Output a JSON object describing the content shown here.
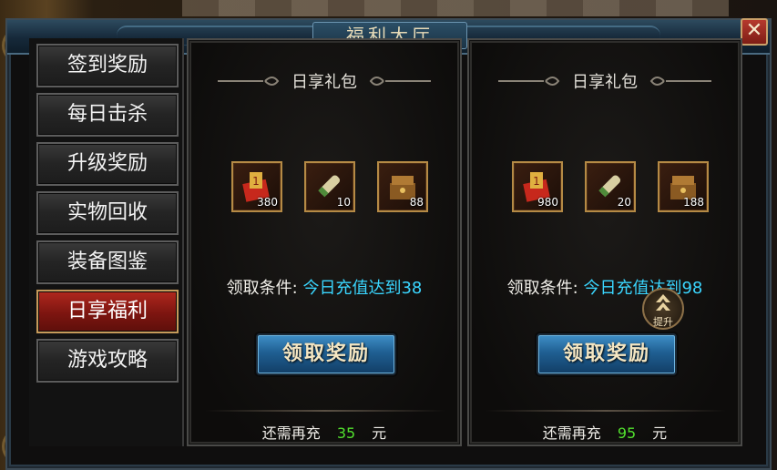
{
  "window": {
    "title": "福利大厅",
    "close_label": "✕"
  },
  "sidebar": {
    "items": [
      {
        "label": "签到奖励",
        "active": false
      },
      {
        "label": "每日击杀",
        "active": false
      },
      {
        "label": "升级奖励",
        "active": false
      },
      {
        "label": "实物回收",
        "active": false
      },
      {
        "label": "装备图鉴",
        "active": false
      },
      {
        "label": "日享福利",
        "active": true
      },
      {
        "label": "游戏攻略",
        "active": false
      }
    ]
  },
  "panels": [
    {
      "title": "日享礼包",
      "items": [
        {
          "icon": "gold-ingot-icon",
          "qty": "380"
        },
        {
          "icon": "scroll-icon",
          "qty": "10"
        },
        {
          "icon": "treasure-chest-icon",
          "qty": "88"
        }
      ],
      "condition_label": "领取条件:",
      "condition_value": "今日充值达到38",
      "claim_label": "领取奖励",
      "need_prefix": "还需再充",
      "need_amount": "35",
      "need_suffix": "元"
    },
    {
      "title": "日享礼包",
      "items": [
        {
          "icon": "gold-ingot-icon",
          "qty": "980"
        },
        {
          "icon": "scroll-icon",
          "qty": "20"
        },
        {
          "icon": "treasure-chest-icon",
          "qty": "188"
        }
      ],
      "condition_label": "领取条件:",
      "condition_value": "今日充值达到98",
      "claim_label": "领取奖励",
      "need_prefix": "还需再充",
      "need_amount": "95",
      "need_suffix": "元"
    }
  ],
  "upgrade_badge": {
    "label": "提升"
  },
  "colors": {
    "active_tab": "#9e2018",
    "condition_value": "#3ad6ff",
    "need_amount": "#52e02e",
    "claim_button": "#1f5f92"
  }
}
